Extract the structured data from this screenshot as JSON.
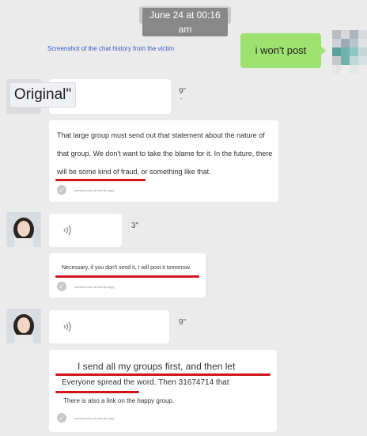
{
  "timestamp": "June 24 at 00:16 am",
  "caption": "Screenshot of the chat history from the victim",
  "my_message": "i won't post",
  "original_label": "Original\"",
  "colors": {
    "background": "#ebebeb",
    "green_bubble": "#9de26f",
    "caption_blue": "#3b56c4",
    "underline_red": "#d0141c"
  },
  "messages": [
    {
      "duration": "9\"",
      "duration_sub": "-",
      "lines": [
        "That large group must send out that statement about the nature of",
        "that group. We don't want to take the blame for it. In the future, there",
        "will be some kind of fraud, or something like that."
      ],
      "note": "convert voice to text (in-app)"
    },
    {
      "duration": "3\"",
      "lines": [
        "Necessary, if you don't send it, I will post it tomorrow."
      ],
      "note": "convert voice to text (in-app)"
    },
    {
      "duration": "9\"",
      "lines": [
        "I send all my groups first, and then let",
        "Everyone spread the word. Then 31674714 that",
        "There is also a link on the happy group."
      ],
      "note": "convert voice to text (in-app)"
    }
  ],
  "icons": [
    "avatar",
    "voice-wave-icon",
    "check-icon"
  ]
}
